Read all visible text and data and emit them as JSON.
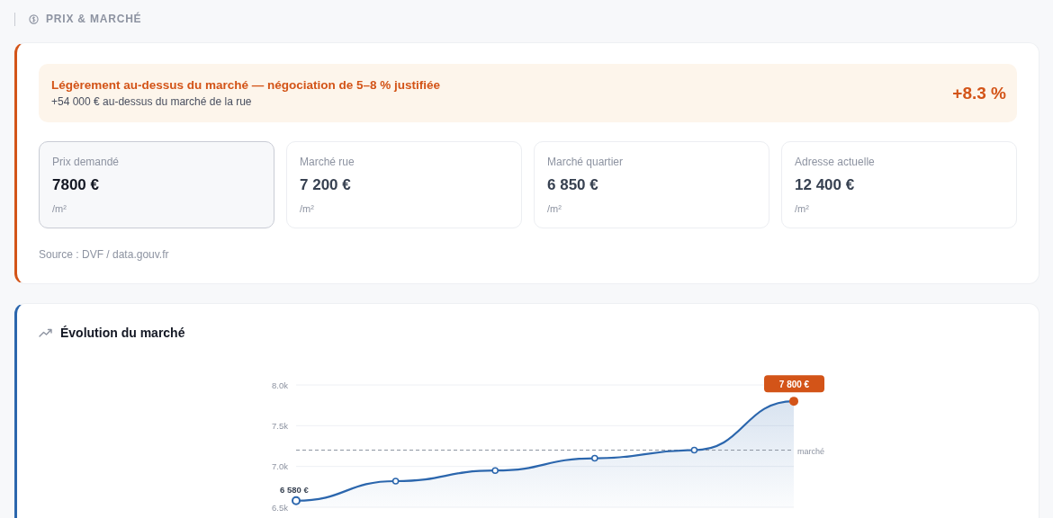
{
  "section": {
    "title": "PRIX & MARCHÉ"
  },
  "verdict": {
    "headline": "Légèrement au-dessus du marché — négociation de 5–8 % justifiée",
    "detail": "+54 000 € au-dessus du marché de la rue",
    "delta": "+8.3 %"
  },
  "metrics": [
    {
      "label": "Prix demandé",
      "value": "7800 €",
      "unit": "/m²",
      "selected": true
    },
    {
      "label": "Marché rue",
      "value": "7 200 €",
      "unit": "/m²",
      "selected": false
    },
    {
      "label": "Marché quartier",
      "value": "6 850 €",
      "unit": "/m²",
      "selected": false
    },
    {
      "label": "Adresse actuelle",
      "value": "12 400 €",
      "unit": "/m²",
      "selected": false
    }
  ],
  "source": "Source : DVF / data.gouv.fr",
  "evolution": {
    "title": "Évolution du marché",
    "chart_data": {
      "type": "area",
      "series": [
        {
          "color": "#2b66ad",
          "values": [
            6580,
            6820,
            6950,
            7100,
            7200,
            7800
          ]
        }
      ],
      "ylim": [
        6500,
        8000
      ],
      "yticks": [
        {
          "value": 6500,
          "label": "6.5k"
        },
        {
          "value": 7000,
          "label": "7.0k"
        },
        {
          "value": 7500,
          "label": "7.5k"
        },
        {
          "value": 8000,
          "label": "8.0k"
        }
      ],
      "ref_lines": [
        {
          "axis": "y",
          "value": 7200,
          "label": "marché"
        }
      ],
      "annotations": [
        {
          "text": "6 580 €",
          "y": 6580
        },
        {
          "text": "7 800 €",
          "y": 7800
        }
      ]
    }
  }
}
